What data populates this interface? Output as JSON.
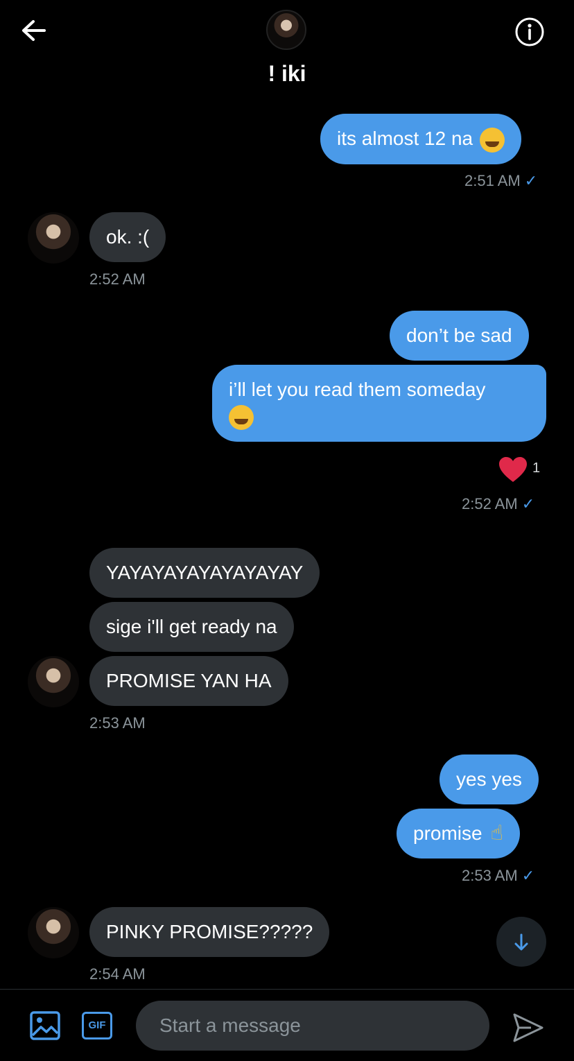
{
  "header": {
    "contact_name": "! iki",
    "back_icon": "arrow-left-icon",
    "info_icon": "info-circle-icon"
  },
  "messages": [
    {
      "text": "its almost 12 na",
      "emoji": "laughing-face-emoji"
    },
    {
      "text": "ok. :("
    },
    {
      "text": "don’t be sad"
    },
    {
      "text": "i’ll let you read them someday",
      "emoji": "grinning-face-emoji"
    },
    {
      "text": "YAYAYAYAYAYAYAYAY"
    },
    {
      "text": "sige i'll get ready na"
    },
    {
      "text": "PROMISE YAN HA"
    },
    {
      "text": "yes yes"
    },
    {
      "text": "promise",
      "emoji": "index-pointing-up-emoji"
    },
    {
      "text": "PINKY PROMISE?????"
    }
  ],
  "timestamps": [
    "2:51 AM",
    "2:52 AM",
    "2:52 AM",
    "2:53 AM",
    "2:53 AM",
    "2:54 AM"
  ],
  "read_check": "✓",
  "reaction": {
    "icon": "heart-icon",
    "count": "1"
  },
  "composer": {
    "placeholder": "Start a message",
    "gif_label": "GIF",
    "image_icon": "image-icon",
    "send_icon": "send-icon"
  },
  "colors": {
    "outgoing_bubble": "#4a9ae9",
    "incoming_bubble": "#2e3236",
    "background": "#000000",
    "timestamp": "#8b949a",
    "heart": "#e0294a"
  }
}
